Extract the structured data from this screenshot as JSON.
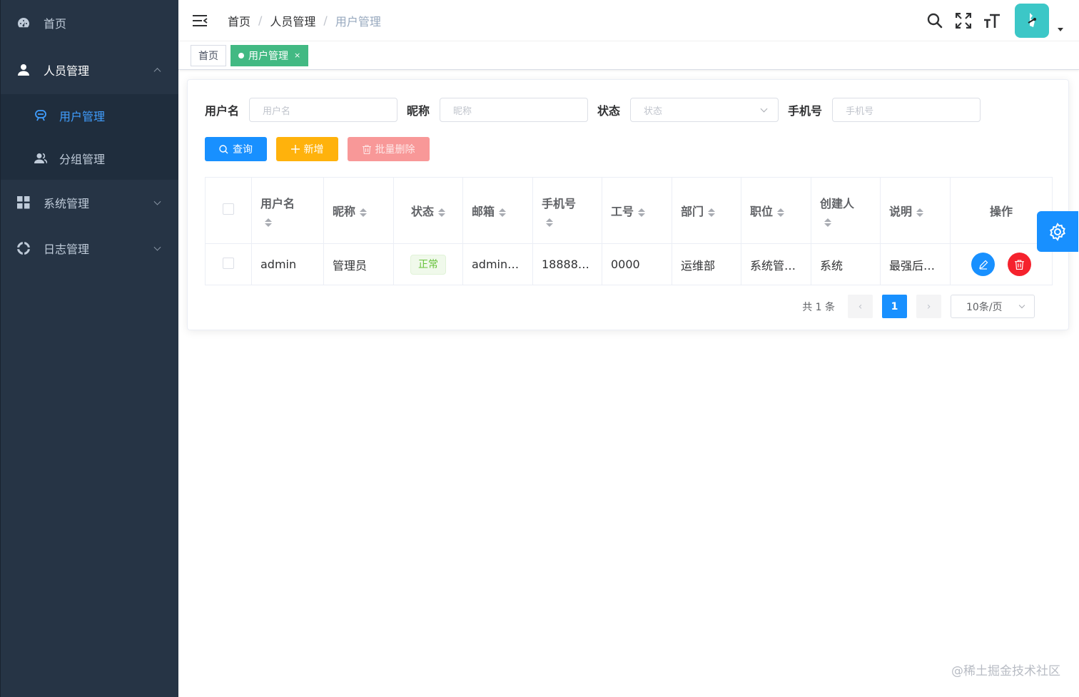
{
  "sidebar": {
    "items": [
      {
        "label": "首页",
        "icon": "dashboard-icon"
      },
      {
        "label": "人员管理",
        "icon": "user-icon",
        "expanded": true,
        "children": [
          {
            "label": "用户管理",
            "icon": "user-manage-icon",
            "active": true
          },
          {
            "label": "分组管理",
            "icon": "group-icon"
          }
        ]
      },
      {
        "label": "系统管理",
        "icon": "grid-icon"
      },
      {
        "label": "日志管理",
        "icon": "log-icon"
      }
    ]
  },
  "header": {
    "breadcrumb": [
      "首页",
      "人员管理",
      "用户管理"
    ],
    "separator": "/"
  },
  "tags": {
    "home": "首页",
    "active": "用户管理",
    "close": "×"
  },
  "filters": {
    "username": {
      "label": "用户名",
      "placeholder": "用户名"
    },
    "nickname": {
      "label": "昵称",
      "placeholder": "昵称"
    },
    "status": {
      "label": "状态",
      "placeholder": "状态"
    },
    "phone": {
      "label": "手机号",
      "placeholder": "手机号"
    }
  },
  "buttons": {
    "query": "查询",
    "add": "新增",
    "batch_delete": "批量删除"
  },
  "table": {
    "headers": [
      "用户名",
      "昵称",
      "状态",
      "邮箱",
      "手机号",
      "工号",
      "部门",
      "职位",
      "创建人",
      "说明",
      "操作"
    ],
    "rows": [
      {
        "username": "admin",
        "nickname": "管理员",
        "status": "正常",
        "email": "admin…",
        "phone": "18888…",
        "job_no": "0000",
        "dept": "运维部",
        "position": "系统管…",
        "creator": "系统",
        "desc": "最强后…"
      }
    ]
  },
  "pagination": {
    "total": "共 1 条",
    "current": "1",
    "page_size": "10条/页",
    "prev": "‹",
    "next": "›"
  },
  "watermark": "@稀土掘金技术社区",
  "colors": {
    "sidebar_bg": "#263445",
    "primary": "#1890ff",
    "tag_active": "#42b983",
    "warning": "#ffb20c",
    "danger": "#f89898",
    "success": "#67c23a"
  }
}
